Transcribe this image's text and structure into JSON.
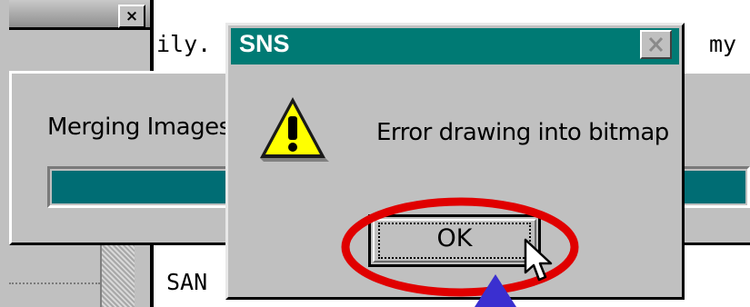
{
  "background_doc": {
    "text_fragments": [
      "ily.",
      "my",
      "SAN"
    ]
  },
  "background_window": {
    "close_glyph": "×"
  },
  "merge_window": {
    "label": "Merging Images",
    "progress_fraction": 1.0,
    "progress_color": "#006d74"
  },
  "dialog": {
    "title": "SNS",
    "message": "Error drawing into bitmap",
    "icon": "warning-icon",
    "ok_label": "OK",
    "title_bar_color": "#007a74"
  },
  "annotations": {
    "highlight_color": "#e00000",
    "arrow_color": "#3a2fd0",
    "cursor": "arrow-pointer"
  }
}
